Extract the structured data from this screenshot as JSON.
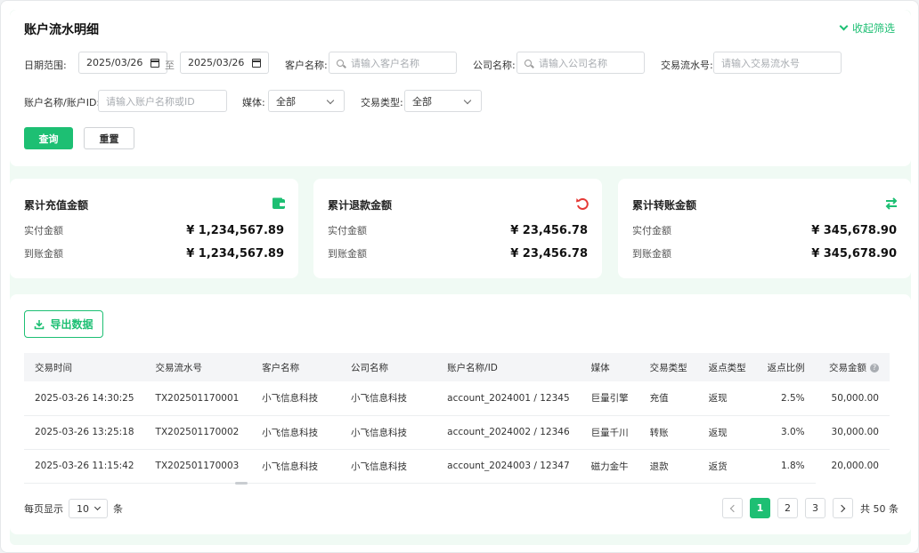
{
  "header": {
    "title": "账户流水明细",
    "collapse_label": "收起筛选"
  },
  "filters": {
    "date_label": "日期范围:",
    "date_from": "2025/03/26",
    "date_sep": "至",
    "date_to": "2025/03/26",
    "customer_label": "客户名称:",
    "customer_placeholder": "请输入客户名称",
    "company_label": "公司名称:",
    "company_placeholder": "请输入公司名称",
    "txn_label": "交易流水号:",
    "txn_placeholder": "请输入交易流水号",
    "account_label": "账户名称/账户ID:",
    "account_placeholder": "请输入账户名称或ID",
    "media_label": "媒体:",
    "media_value": "全部",
    "type_label": "交易类型:",
    "type_value": "全部",
    "query_label": "查询",
    "reset_label": "重置"
  },
  "stats": [
    {
      "title": "累计充值金额",
      "icon": "wallet-icon",
      "paid_label": "实付金额",
      "paid_value": "¥ 1,234,567.89",
      "recv_label": "到账金额",
      "recv_value": "¥ 1,234,567.89"
    },
    {
      "title": "累计退款金额",
      "icon": "refund-icon",
      "paid_label": "实付金额",
      "paid_value": "¥ 23,456.78",
      "recv_label": "到账金额",
      "recv_value": "¥ 23,456.78"
    },
    {
      "title": "累计转账金额",
      "icon": "transfer-icon",
      "paid_label": "实付金额",
      "paid_value": "¥ 345,678.90",
      "recv_label": "到账金额",
      "recv_value": "¥ 345,678.90"
    }
  ],
  "table": {
    "export_label": "导出数据",
    "columns": [
      "交易时间",
      "交易流水号",
      "客户名称",
      "公司名称",
      "账户名称/ID",
      "媒体",
      "交易类型",
      "返点类型",
      "返点比例",
      "交易金额"
    ],
    "rows": [
      [
        "2025-03-26 14:30:25",
        "TX202501170001",
        "小飞信息科技",
        "小飞信息科技",
        "account_2024001 / 12345",
        "巨量引擎",
        "充值",
        "返现",
        "2.5%",
        "50,000.00"
      ],
      [
        "2025-03-26 13:25:18",
        "TX202501170002",
        "小飞信息科技",
        "小飞信息科技",
        "account_2024002 / 12346",
        "巨量千川",
        "转账",
        "返现",
        "3.0%",
        "30,000.00"
      ],
      [
        "2025-03-26 11:15:42",
        "TX202501170003",
        "小飞信息科技",
        "小飞信息科技",
        "account_2024003 / 12347",
        "磁力金牛",
        "退款",
        "返货",
        "1.8%",
        "20,000.00"
      ]
    ]
  },
  "pagination": {
    "per_page_label": "每页显示",
    "per_page_value": "10",
    "per_page_unit": "条",
    "pages": [
      "1",
      "2",
      "3"
    ],
    "current": "1",
    "total_label": "共 50 条"
  },
  "colors": {
    "accent": "#1dbf73",
    "refund": "#e53935",
    "background": "#f0faf4"
  }
}
